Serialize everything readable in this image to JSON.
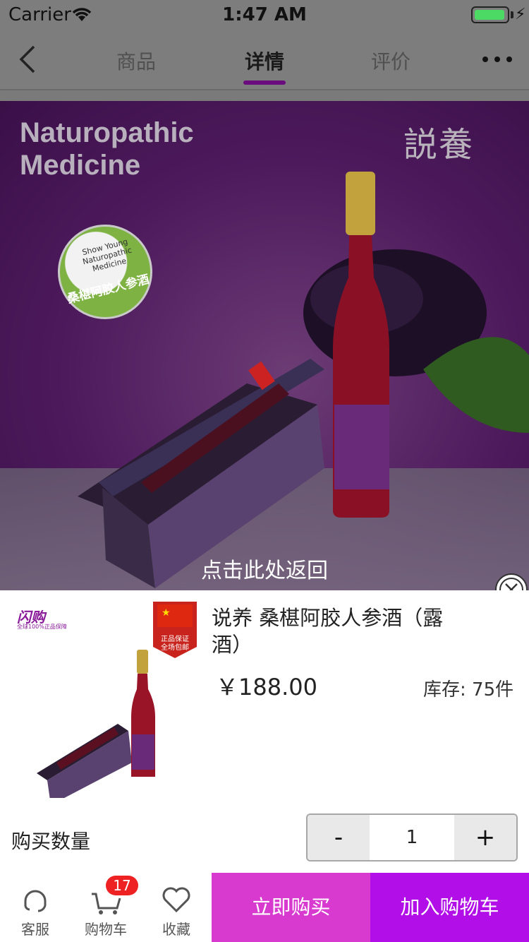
{
  "status_bar": {
    "carrier": "Carrier",
    "time": "1:47 AM",
    "battery_level": 0.95,
    "charging_icon": "bolt-icon"
  },
  "nav": {
    "tabs": [
      {
        "label": "商品"
      },
      {
        "label": "详情"
      },
      {
        "label": "评价"
      }
    ],
    "active_tab": 1,
    "accent_color": "#6a0b7e"
  },
  "hero": {
    "title_line1": "Naturopathic",
    "title_line2": "Medicine",
    "brand": "説養",
    "badge_top": "Show Young Naturopathic Medicine",
    "badge_bottom": "桑椹阿胶人参酒",
    "return_text": "点击此处返回"
  },
  "sheet": {
    "thumb_logo": "闪购",
    "thumb_logo_sub": "全球100%正品保障",
    "flag_text_line1": "正品保证",
    "flag_text_line2": "全场包邮",
    "product_name": "说养 桑椹阿胶人参酒（露酒）",
    "price": "￥188.00",
    "stock": "库存: 75件",
    "quantity_label": "购买数量",
    "quantity": "1",
    "minus": "-",
    "plus": "+"
  },
  "action_bar": {
    "service_label": "客服",
    "cart_label": "购物车",
    "cart_count": "17",
    "favorite_label": "收藏",
    "buy_now": "立即购买",
    "add_to_cart": "加入购物车",
    "buy_now_color": "#d83ad0",
    "add_to_cart_color": "#b20ee8"
  }
}
